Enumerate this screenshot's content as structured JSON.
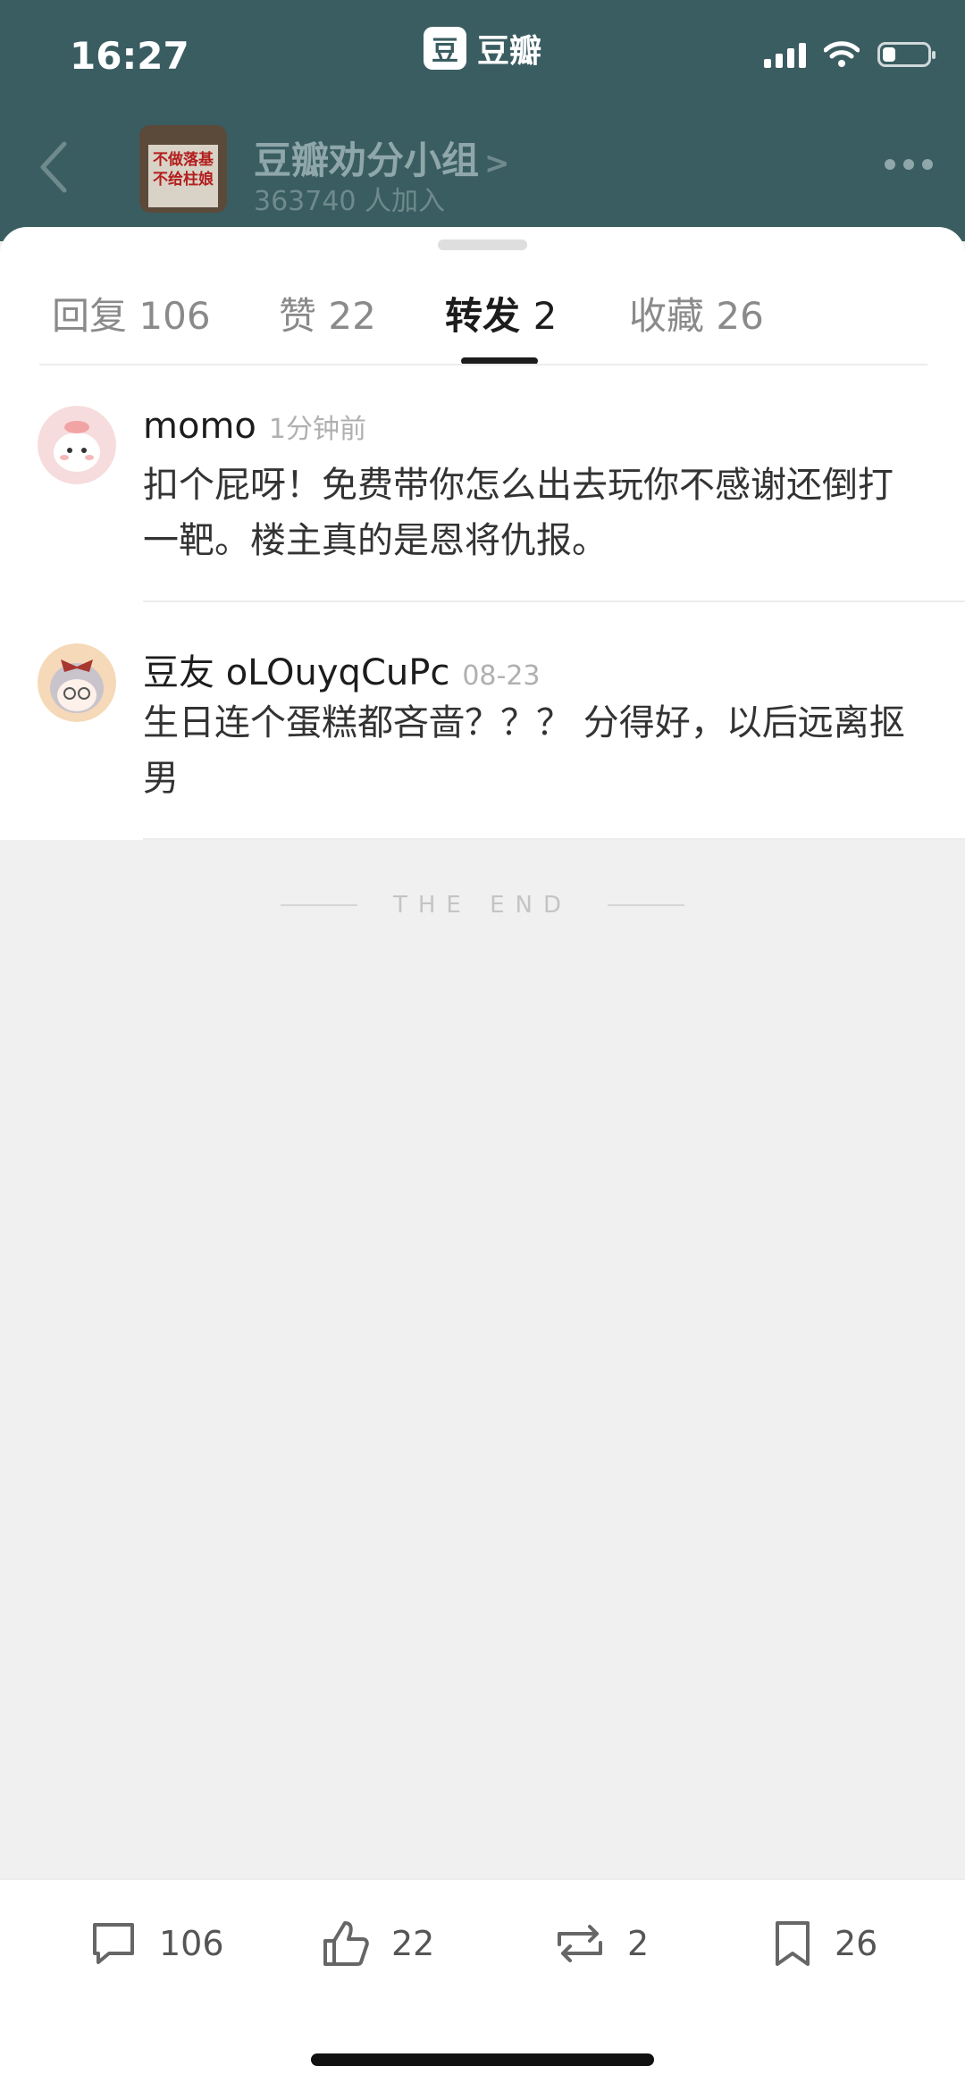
{
  "status": {
    "time": "16:27"
  },
  "app": {
    "logo": "豆",
    "name": "豆瓣"
  },
  "group": {
    "name": "豆瓣劝分小组",
    "chevron": ">",
    "members": "363740 人加入",
    "thumb_line1": "不做落基",
    "thumb_line2": "不给柱娘"
  },
  "tabs": [
    {
      "label": "回复",
      "count": "106",
      "active": false
    },
    {
      "label": "赞",
      "count": "22",
      "active": false
    },
    {
      "label": "转发",
      "count": "2",
      "active": true
    },
    {
      "label": "收藏",
      "count": "26",
      "active": false
    }
  ],
  "comments": [
    {
      "user": "momo",
      "time": "1分钟前",
      "text": "扣个屁呀！免费带你怎么出去玩你不感谢还倒打一靶。楼主真的是恩将仇报。"
    },
    {
      "user": "豆友 oLOuyqCuPc",
      "time": "08-23",
      "text": "生日连个蛋糕都吝啬？？？ 分得好，以后远离抠男"
    }
  ],
  "end_text": "THE END",
  "bottom_bar": {
    "reply_count": "106",
    "like_count": "22",
    "repost_count": "2",
    "collect_count": "26"
  },
  "colors": {
    "header": "#3a5d61",
    "sheet": "#ffffff",
    "background": "#f0f0f0"
  }
}
